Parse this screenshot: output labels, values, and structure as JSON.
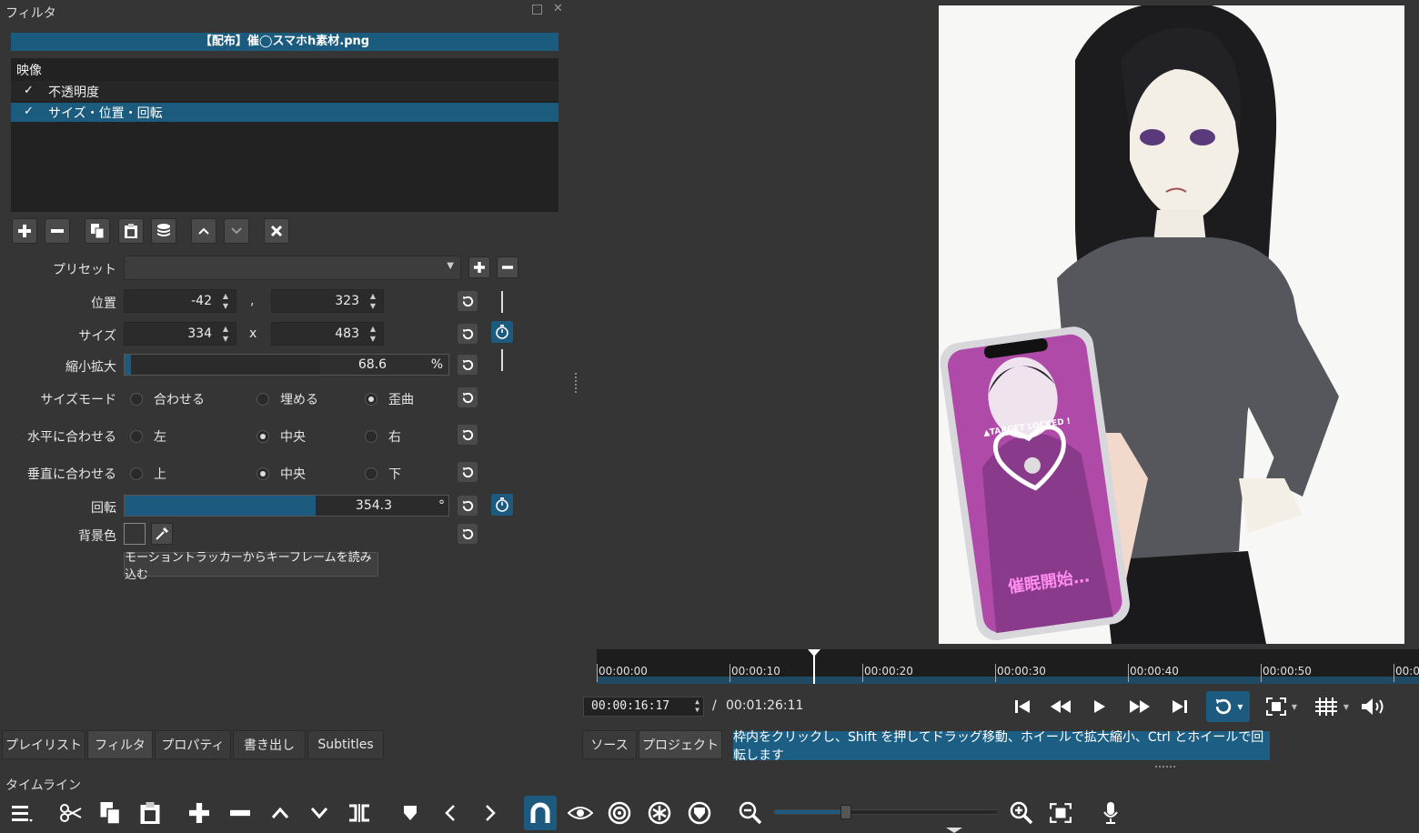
{
  "filter_panel": {
    "title": "フィルタ",
    "clip_name": "【配布】催◯スマホh素材.png",
    "category": "映像",
    "filters": [
      {
        "label": "不透明度",
        "checked": true
      },
      {
        "label": "サイズ・位置・回転",
        "checked": true
      }
    ],
    "toolbar_icons": [
      "add-icon",
      "remove-icon",
      "copy-icon",
      "paste-icon",
      "save-preset-icon",
      "move-up-icon",
      "move-down-icon",
      "close-icon"
    ]
  },
  "params": {
    "preset_label": "プリセット",
    "position_label": "位置",
    "position_x": "-42",
    "position_sep": ",",
    "position_y": "323",
    "size_label": "サイズ",
    "size_w": "334",
    "size_sep": "x",
    "size_h": "483",
    "zoom_label": "縮小拡大",
    "zoom_value": "68.6",
    "zoom_unit": "%",
    "zoom_fraction": 0.02,
    "sizemode_label": "サイズモード",
    "sizemode_options": [
      "合わせる",
      "埋める",
      "歪曲"
    ],
    "sizemode_selected": 2,
    "halign_label": "水平に合わせる",
    "halign_options": [
      "左",
      "中央",
      "右"
    ],
    "halign_selected": 1,
    "valign_label": "垂直に合わせる",
    "valign_options": [
      "上",
      "中央",
      "下"
    ],
    "valign_selected": 1,
    "rotation_label": "回転",
    "rotation_value": "354.3",
    "rotation_unit": "°",
    "rotation_fraction": 0.59,
    "bgcolor_label": "背景色",
    "motion_button": "モーショントラッカーからキーフレームを読み込む"
  },
  "left_tabs": [
    "プレイリスト",
    "フィルタ",
    "プロパティ",
    "書き出し",
    "Subtitles"
  ],
  "left_active_tab": 1,
  "player": {
    "ruler_ticks": [
      "00:00:00",
      "00:00:10",
      "00:00:20",
      "00:00:30",
      "00:00:40",
      "00:00:50",
      "00:0"
    ],
    "current_time": "00:00:16:17",
    "time_sep": "/",
    "duration": "00:01:26:11",
    "phone_text_top": "▲TARGET LOCKED !",
    "phone_text_bottom": "催眠開始…",
    "tabs": [
      "ソース",
      "プロジェクト"
    ],
    "status_hint": "枠内をクリックし、Shift を押してドラッグ移動、ホイールで拡大縮小、Ctrl とホイールで回転します"
  },
  "timeline": {
    "title": "タイムライン",
    "icons": [
      "menu-icon",
      "cut-icon",
      "copy-icon",
      "paste-icon",
      "add-icon",
      "remove-icon",
      "lift-icon",
      "overwrite-icon",
      "split-icon",
      "marker-icon",
      "prev-marker-icon",
      "next-marker-icon",
      "snap-icon",
      "scrub-icon",
      "ripple-icon",
      "ripple-all-icon",
      "ripple-markers-icon",
      "zoom-out-icon",
      "zoom-in-icon",
      "zoom-fit-icon",
      "record-audio-icon"
    ],
    "zoom_fraction": 0.32
  },
  "colors": {
    "accent": "#1c5a80",
    "selection": "#1b5b7e",
    "hint_bg": "#1d5f84"
  }
}
